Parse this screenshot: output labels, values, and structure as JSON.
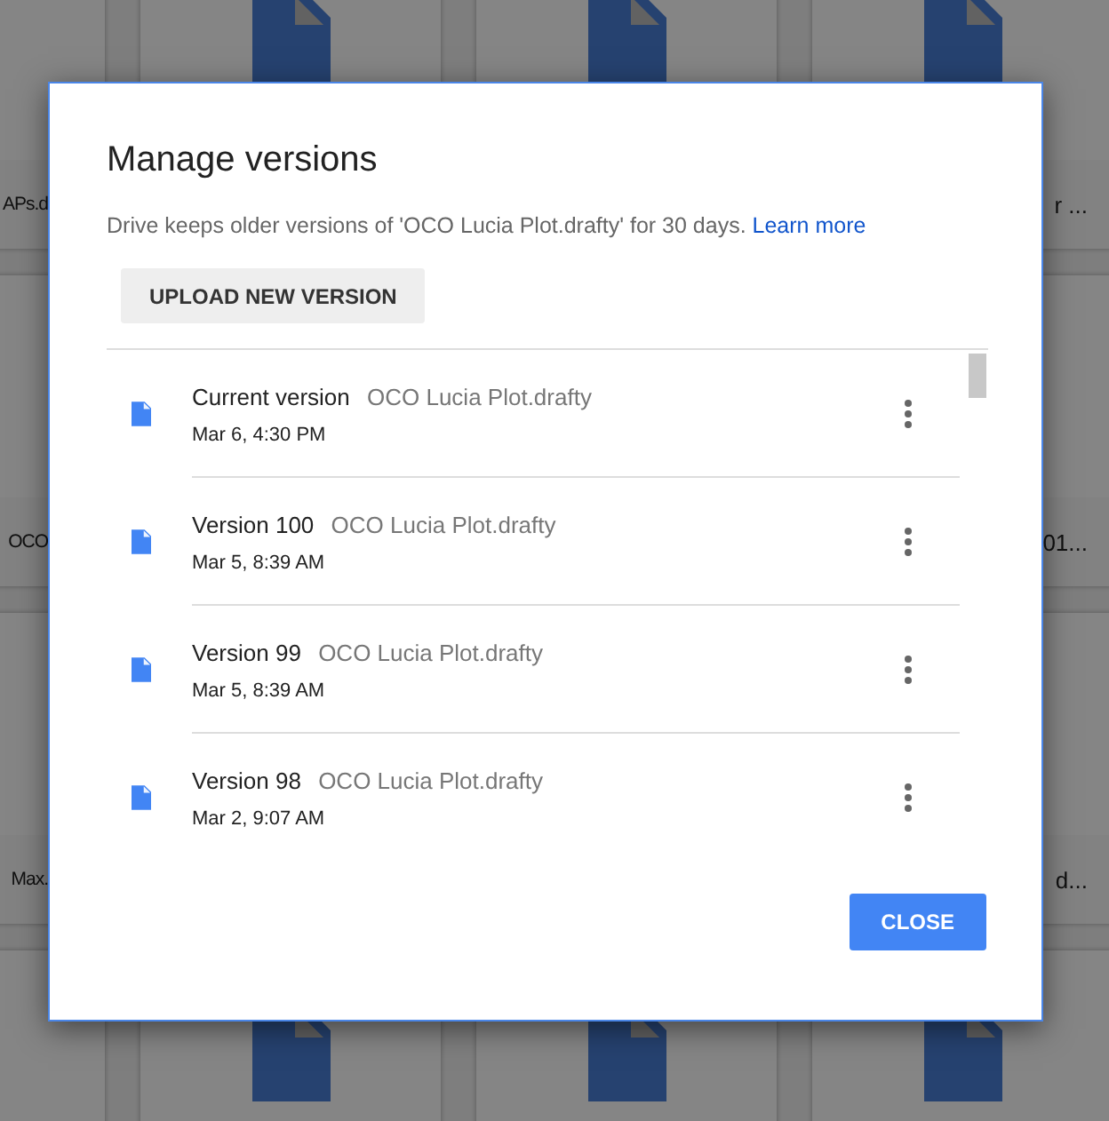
{
  "background_files_left_column": [
    "APs.d",
    "OCO",
    "Max."
  ],
  "background_files_right_column": [
    "r ...",
    "01...",
    "d..."
  ],
  "dialog": {
    "title": "Manage versions",
    "description": "Drive keeps older versions of 'OCO Lucia Plot.drafty' for 30 days.",
    "learn_more_link": "Learn more",
    "upload_button": "UPLOAD NEW VERSION",
    "versions": [
      {
        "label": "Current version",
        "file": "OCO Lucia Plot.drafty",
        "date": "Mar 6, 4:30 PM"
      },
      {
        "label": "Version 100",
        "file": "OCO Lucia Plot.drafty",
        "date": "Mar 5, 8:39 AM"
      },
      {
        "label": "Version 99",
        "file": "OCO Lucia Plot.drafty",
        "date": "Mar 5, 8:39 AM"
      },
      {
        "label": "Version 98",
        "file": "OCO Lucia Plot.drafty",
        "date": "Mar 2, 9:07 AM"
      }
    ],
    "close_button": "CLOSE"
  }
}
